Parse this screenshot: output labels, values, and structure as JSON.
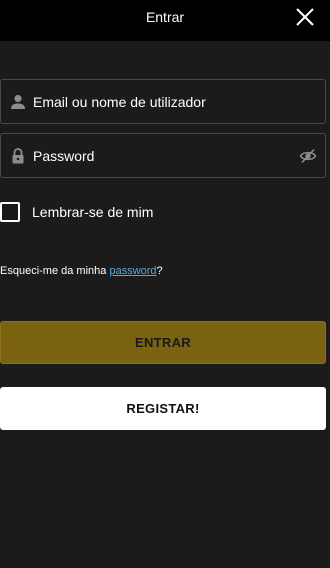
{
  "header": {
    "title": "Entrar",
    "close_icon": "close-icon"
  },
  "form": {
    "email_placeholder": "Email ou nome de utilizador",
    "email_icon": "user-icon",
    "password_placeholder": "Password",
    "password_icon": "lock-icon",
    "visibility_icon": "eye-off-icon",
    "remember_label": "Lembrar-se de mim",
    "remember_checked": false,
    "forgot_prefix": "Esqueci-me da minha ",
    "forgot_link": "password",
    "forgot_suffix": "?"
  },
  "buttons": {
    "login_label": "ENTRAR",
    "register_label": "REGISTAR!"
  },
  "colors": {
    "background": "#1b1b1b",
    "header": "#000000",
    "login_button": "#7a6210",
    "link": "#5aa8e0"
  }
}
